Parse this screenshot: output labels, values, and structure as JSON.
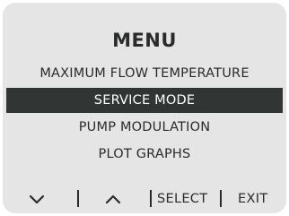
{
  "menu": {
    "title": "MENU",
    "items": [
      {
        "label": "MAXIMUM FLOW TEMPERATURE",
        "selected": false
      },
      {
        "label": "SERVICE MODE",
        "selected": true
      },
      {
        "label": "PUMP MODULATION",
        "selected": false
      },
      {
        "label": "PLOT GRAPHS",
        "selected": false
      }
    ]
  },
  "softkeys": {
    "down_icon": "chevron-down-icon",
    "up_icon": "chevron-up-icon",
    "select_label": "SELECT",
    "exit_label": "EXIT"
  },
  "colors": {
    "screen_background": "#e4e5e4",
    "text": "#2a2c2c",
    "selection_background": "#313635",
    "selection_text": "#ffffff"
  }
}
